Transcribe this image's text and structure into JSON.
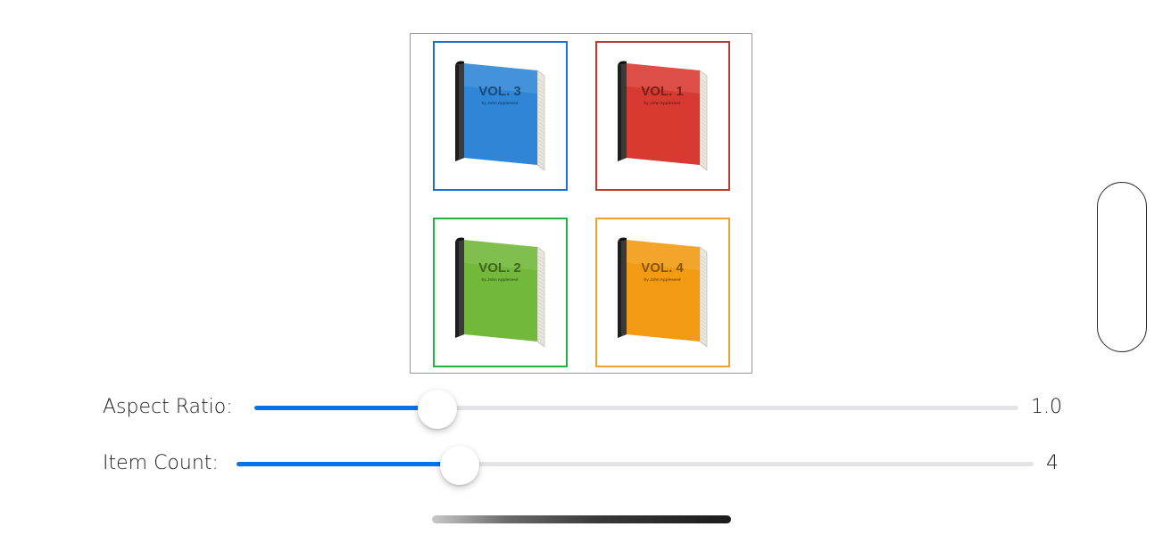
{
  "grid": {
    "items": [
      {
        "label": "VOL. 3",
        "author": "by John Appleseed",
        "book_color": "#2f86d6",
        "border_color": "#1a6fd8"
      },
      {
        "label": "VOL. 1",
        "author": "by John Appleseed",
        "book_color": "#d83a32",
        "border_color": "#c0392b"
      },
      {
        "label": "VOL. 2",
        "author": "by John Appleseed",
        "book_color": "#72b83a",
        "border_color": "#27ae45"
      },
      {
        "label": "VOL. 4",
        "author": "by John Appleseed",
        "book_color": "#f29a12",
        "border_color": "#f0a030"
      }
    ]
  },
  "sliders": {
    "aspect_ratio": {
      "label": "Aspect Ratio:",
      "value_text": "1.0",
      "fraction": 0.24
    },
    "item_count": {
      "label": "Item Count:",
      "value_text": "4",
      "fraction": 0.28
    }
  },
  "colors": {
    "accent": "#0a72e8",
    "track": "#e4e4e6"
  }
}
